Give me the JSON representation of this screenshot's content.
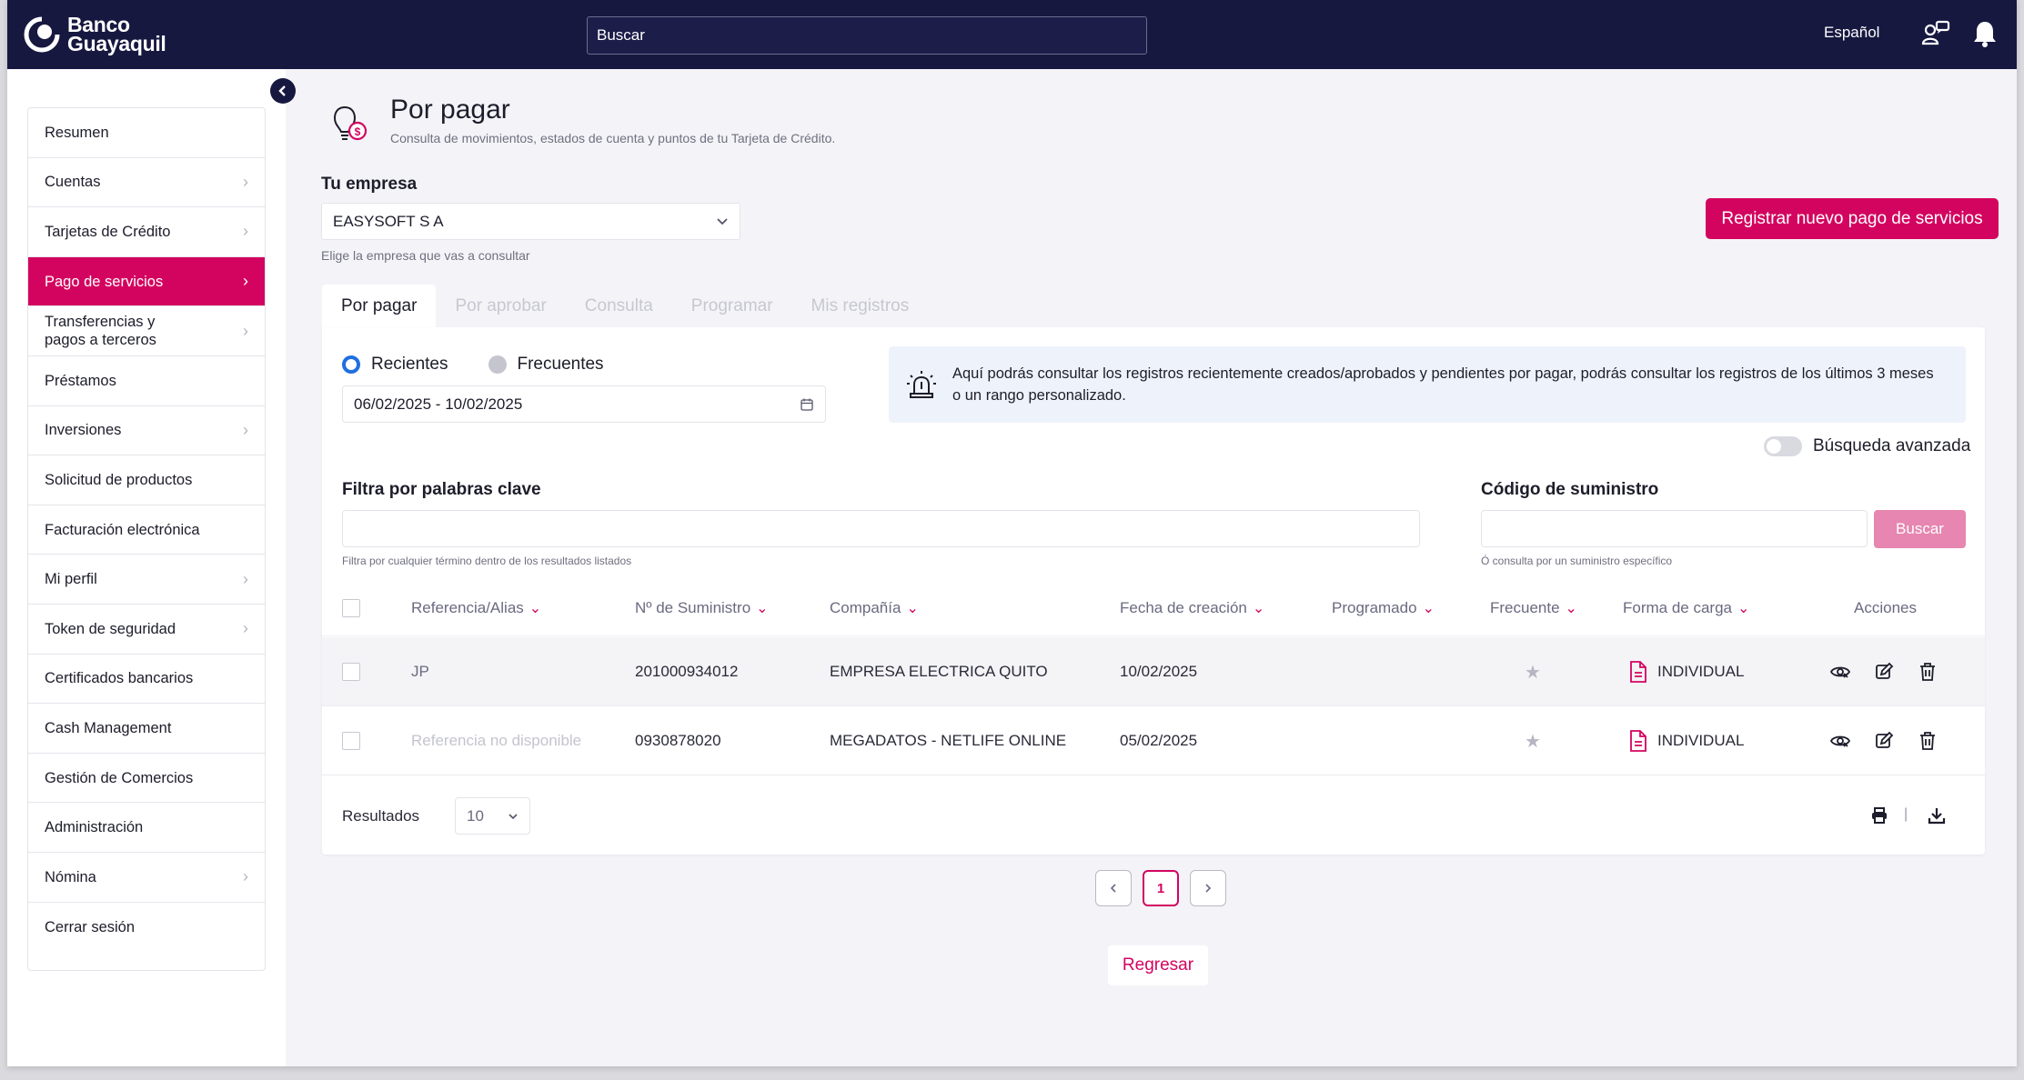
{
  "brand": {
    "name_line1": "Banco",
    "name_line2": "Guayaquil",
    "accent": "#d3045f",
    "navy": "#171840"
  },
  "topbar": {
    "search_placeholder": "Buscar",
    "language": "Español",
    "icons": [
      "user-settings-icon",
      "bell-icon"
    ]
  },
  "sidebar": {
    "items": [
      {
        "label": "Resumen",
        "chevron": false
      },
      {
        "label": "Cuentas",
        "chevron": true
      },
      {
        "label": "Tarjetas de Crédito",
        "chevron": true
      },
      {
        "label": "Pago de servicios",
        "chevron": true,
        "active": true
      },
      {
        "label": "Transferencias y pagos a terceros",
        "chevron": true
      },
      {
        "label": "Préstamos",
        "chevron": false
      },
      {
        "label": "Inversiones",
        "chevron": true
      },
      {
        "label": "Solicitud de productos",
        "chevron": false
      },
      {
        "label": "Facturación electrónica",
        "chevron": false
      },
      {
        "label": "Mi perfil",
        "chevron": true
      },
      {
        "label": "Token de seguridad",
        "chevron": true
      },
      {
        "label": "Certificados bancarios",
        "chevron": false
      },
      {
        "label": "Cash Management",
        "chevron": false
      },
      {
        "label": "Gestión de Comercios",
        "chevron": false
      },
      {
        "label": "Administración",
        "chevron": false
      },
      {
        "label": "Nómina",
        "chevron": true
      },
      {
        "label": "Cerrar sesión",
        "chevron": false
      }
    ]
  },
  "page": {
    "title": "Por pagar",
    "subtitle": "Consulta de movimientos, estados de cuenta y puntos de tu Tarjeta de Crédito.",
    "company_label": "Tu empresa",
    "company_value": "EASYSOFT S A",
    "company_hint": "Elige la empresa que vas a consultar",
    "new_button": "Registrar nuevo pago de servicios"
  },
  "tabs": [
    {
      "label": "Por pagar",
      "active": true
    },
    {
      "label": "Por aprobar"
    },
    {
      "label": "Consulta"
    },
    {
      "label": "Programar"
    },
    {
      "label": "Mis registros"
    }
  ],
  "filters": {
    "radio_recent": "Recientes",
    "radio_frequent": "Frecuentes",
    "selected": "Recientes",
    "date_range": "06/02/2025 - 10/02/2025",
    "info_text": "Aquí podrás consultar los registros recientemente creados/aprobados y pendientes por pagar, podrás consultar los registros de los últimos 3 meses o un rango personalizado.",
    "advanced_search": "Búsqueda avanzada",
    "keyword_label": "Filtra por palabras clave",
    "keyword_hint": "Filtra por cualquier término dentro de los resultados listados",
    "supply_label": "Código de suministro",
    "supply_hint": "Ó consulta por un suministro específico",
    "search_button": "Buscar"
  },
  "table": {
    "headers": [
      "Referencia/Alias",
      "Nº de Suministro",
      "Compañía",
      "Fecha de creación",
      "Programado",
      "Frecuente",
      "Forma de carga",
      "Acciones"
    ],
    "rows": [
      {
        "ref": "JP",
        "ref_muted": false,
        "supply": "201000934012",
        "company": "EMPRESA ELECTRICA QUITO",
        "date": "10/02/2025",
        "scheduled": "",
        "load_type": "INDIVIDUAL"
      },
      {
        "ref": "Referencia no disponible",
        "ref_muted": true,
        "supply": "0930878020",
        "company": "MEGADATOS - NETLIFE ONLINE",
        "date": "05/02/2025",
        "scheduled": "",
        "load_type": "INDIVIDUAL"
      }
    ],
    "results_label": "Resultados",
    "page_size": "10"
  },
  "pagination": {
    "current": "1"
  },
  "back_button": "Regresar"
}
